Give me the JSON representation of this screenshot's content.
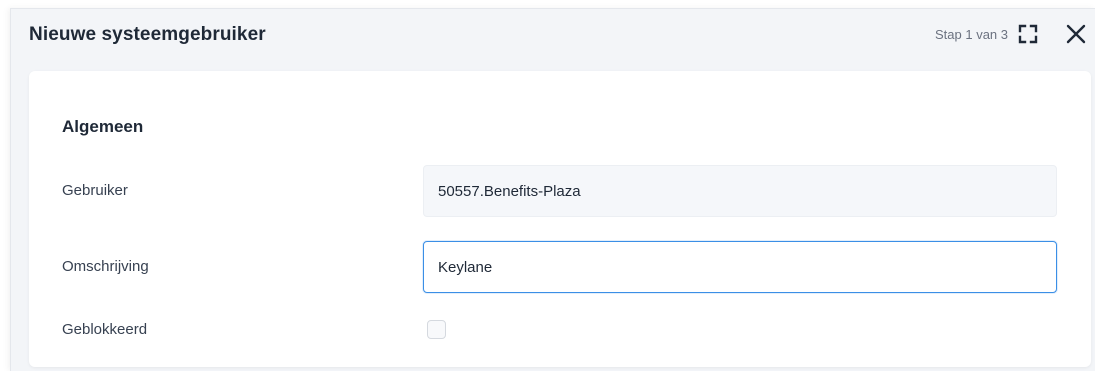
{
  "dialog": {
    "title": "Nieuwe systeemgebruiker",
    "step": "Stap 1 van 3",
    "expand_icon": "expand-icon",
    "close_icon": "close-icon"
  },
  "section": {
    "title": "Algemeen"
  },
  "fields": {
    "gebruiker": {
      "label": "Gebruiker",
      "value": "50557.Benefits-Plaza"
    },
    "omschrijving": {
      "label": "Omschrijving",
      "value": "Keylane"
    },
    "geblokkeerd": {
      "label": "Geblokkeerd",
      "checked": false
    }
  },
  "colors": {
    "focus_border": "#3b8fe6",
    "header_bg": "#f3f5f8"
  }
}
